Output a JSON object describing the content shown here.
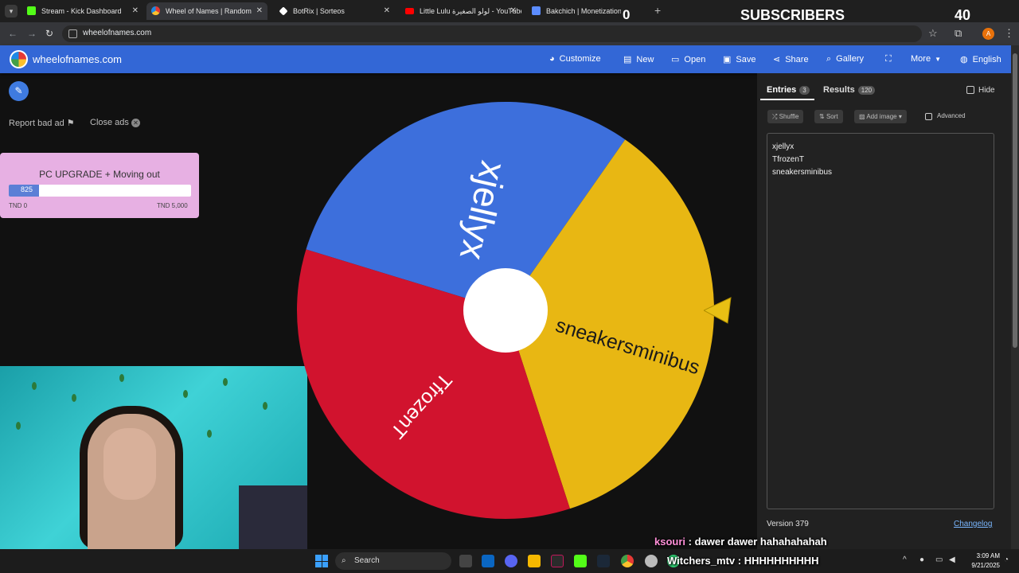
{
  "browser": {
    "tabs": [
      {
        "title": "Stream - Kick Dashboard",
        "color": "#53fc18"
      },
      {
        "title": "Wheel of Names | Random",
        "color": "#e53935"
      },
      {
        "title": "BotRix | Sorteos",
        "color": "#ffffff"
      },
      {
        "title": "Little Lulu لولو الصغيرة - YouTube",
        "color": "#ff0000"
      },
      {
        "title": "Bakchich | Monetization for",
        "color": "#5b8cff"
      }
    ],
    "url": "wheelofnames.com",
    "profile_initial": "A"
  },
  "stream_overlay": {
    "count_left": "0",
    "subscribers_label": "SUBSCRIBERS",
    "subscribers_count": "40"
  },
  "site": {
    "title": "wheelofnames.com",
    "nav": [
      {
        "label": "Customize",
        "icon": "palette-icon"
      },
      {
        "label": "New",
        "icon": "file-icon"
      },
      {
        "label": "Open",
        "icon": "folder-icon"
      },
      {
        "label": "Save",
        "icon": "save-icon"
      },
      {
        "label": "Share",
        "icon": "share-icon"
      },
      {
        "label": "Gallery",
        "icon": "search-icon"
      },
      {
        "label": "",
        "icon": "fullscreen-icon"
      },
      {
        "label": "More",
        "icon": "chevron-down-icon"
      },
      {
        "label": "English",
        "icon": "globe-icon"
      }
    ]
  },
  "left": {
    "report_label": "Report bad ad",
    "close_ads_label": "Close ads"
  },
  "goal": {
    "title": "PC UPGRADE + Moving out",
    "current": "825",
    "fraction": 0.165,
    "min_label": "TND 0",
    "max_label": "TND 5,000"
  },
  "wheel": {
    "segments": [
      {
        "name": "xjellyx",
        "color": "#3d6fdc"
      },
      {
        "name": "sneakersminibus",
        "color": "#e8b713"
      },
      {
        "name": "TfrozenT",
        "color": "#d1132e"
      }
    ]
  },
  "panel": {
    "entries_tab": "Entries",
    "entries_count": "3",
    "results_tab": "Results",
    "results_count": "120",
    "hide_label": "Hide",
    "shuffle_label": "Shuffle",
    "sort_label": "Sort",
    "add_image_label": "Add image",
    "advanced_label": "Advanced",
    "entries": [
      "xjellyx",
      "TfrozenT",
      "sneakersminibus"
    ],
    "version": "Version 379",
    "changelog": "Changelog"
  },
  "chat": [
    {
      "user": "ksouri",
      "message": " : dawer dawer hahahahahah"
    },
    {
      "user": "Witchers_mtv",
      "message": " : HHHHHHHHHH"
    }
  ],
  "taskbar": {
    "search_label": "Search",
    "time": "3:09 AM",
    "date": "9/21/2025"
  }
}
